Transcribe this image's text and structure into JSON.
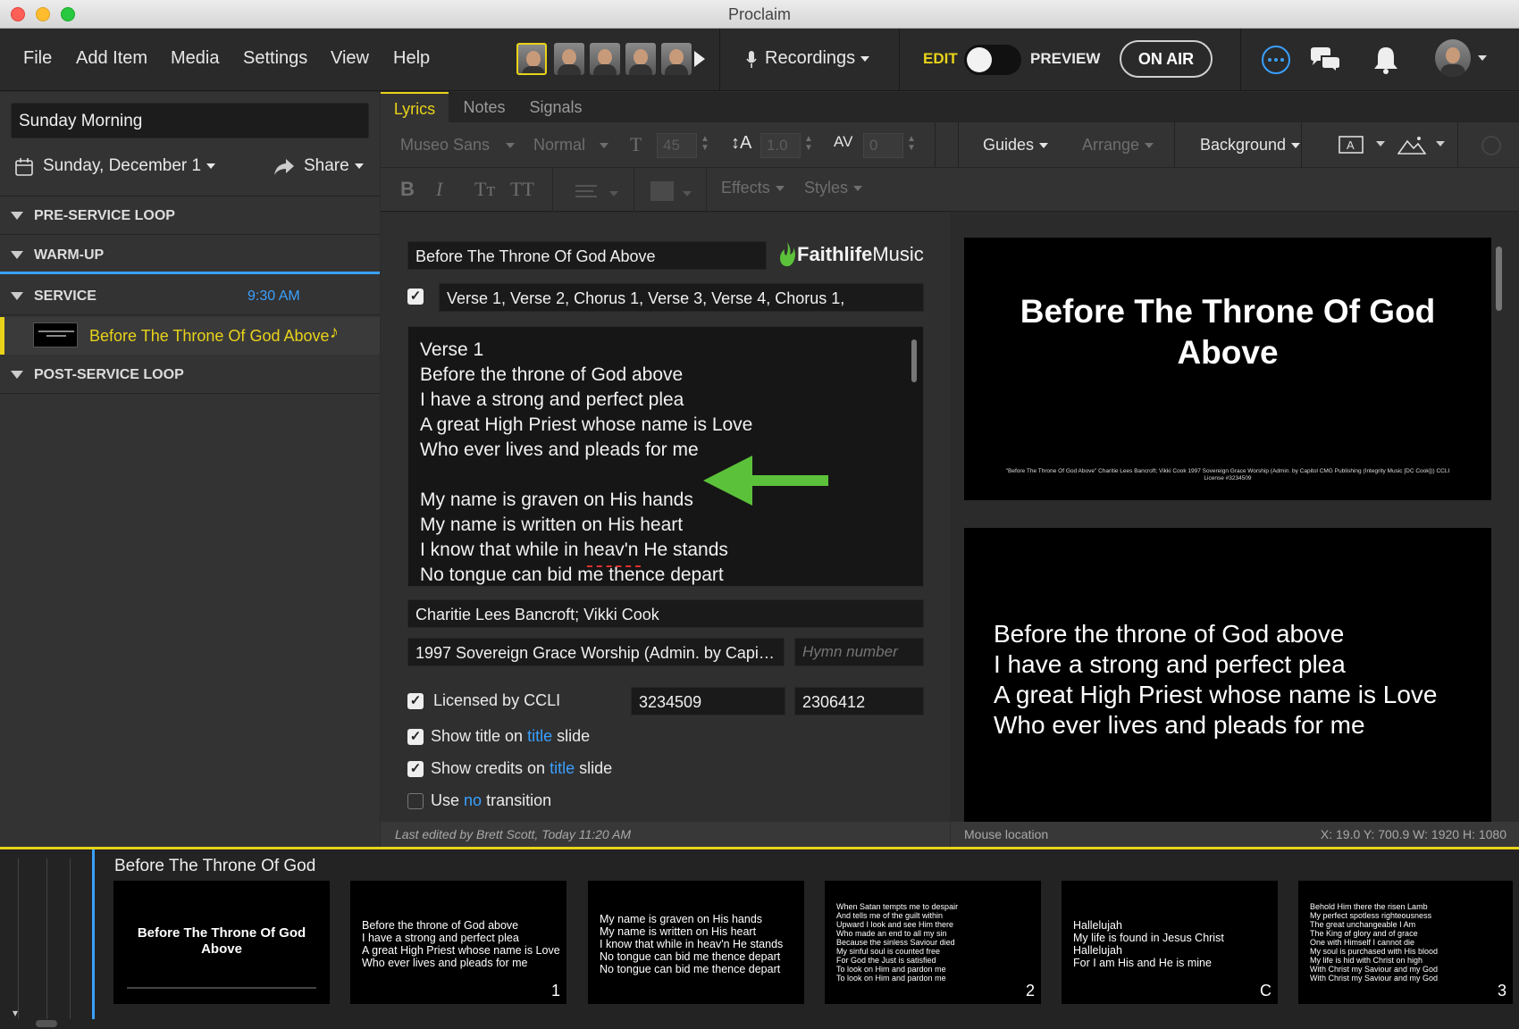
{
  "window": {
    "title": "Proclaim"
  },
  "menu": {
    "file": "File",
    "add_item": "Add Item",
    "media": "Media",
    "settings": "Settings",
    "view": "View",
    "help": "Help",
    "recordings": "Recordings",
    "edit": "EDIT",
    "preview": "PREVIEW",
    "on_air": "ON AIR"
  },
  "colors": {
    "accent_yellow": "#e9d31a",
    "link_blue": "#3aa0ff",
    "arrow_green": "#5cc13a"
  },
  "sidebar": {
    "presentation_name": "Sunday Morning",
    "date": "Sunday, December 1",
    "share": "Share",
    "sections": [
      {
        "label": "PRE-SERVICE LOOP"
      },
      {
        "label": "WARM-UP"
      },
      {
        "label": "SERVICE",
        "time": "9:30 AM"
      },
      {
        "label": "POST-SERVICE LOOP"
      }
    ],
    "service_item": "Before The Throne Of God Above"
  },
  "tabs": [
    "Lyrics",
    "Notes",
    "Signals"
  ],
  "toolbar": {
    "font": "Museo Sans",
    "weight": "Normal",
    "size": "45",
    "line_height": "1.0",
    "spacing": "0",
    "guides": "Guides",
    "arrange": "Arrange",
    "background": "Background",
    "effects": "Effects",
    "styles": "Styles"
  },
  "editor": {
    "title": "Before The Throne Of God Above",
    "brand": {
      "bold": "Faithlife",
      "light": "Music"
    },
    "order": "Verse 1, Verse 2, Chorus 1, Verse 3, Verse 4, Chorus 1,",
    "lyrics": [
      "Verse 1",
      "Before the throne of God above",
      "I have a strong and perfect plea",
      "A great High Priest whose name is Love",
      "Who ever lives and pleads for me",
      "",
      "My name is graven on His hands",
      "My name is written on His heart",
      "I know that while in heav'n He stands",
      "No tongue can bid me thence depart"
    ],
    "authors": "Charitie Lees Bancroft; Vikki Cook",
    "copyright": "1997 Sovereign Grace Worship (Admin. by Capitol CMG Publishing (Integrity Music [DC Cook]))",
    "hymn_placeholder": "Hymn number",
    "licensed": "Licensed by CCLI",
    "ccli_license": "3234509",
    "ccli_song": "2306412",
    "opt_title": {
      "a": "Show title on",
      "link": "title",
      "b": "slide"
    },
    "opt_credits": {
      "a": "Show credits on",
      "link": "title",
      "b": "slide"
    },
    "opt_transition": {
      "a": "Use",
      "link": "no",
      "b": "transition"
    },
    "last_edited": "Last edited by Brett Scott, Today 11:20 AM"
  },
  "preview": {
    "title_slide": {
      "title_line1": "Before The Throne Of God",
      "title_line2": "Above",
      "credit_line1": "\"Before The Throne Of God Above\" Charitie Lees Bancroft; Vikki Cook 1997 Sovereign Grace Worship (Admin. by Capitol CMG Publishing (Integrity Music [DC Cook])) CCLI",
      "credit_line2": "License #3234509"
    },
    "verse_slide": [
      "Before the throne of God above",
      "I have a strong and perfect plea",
      "A great High Priest whose name is Love",
      "Who ever lives and pleads for me"
    ],
    "mouse_location": "Mouse location",
    "coords": "X: 19.0  Y: 700.9   W: 1920  H: 1080"
  },
  "strip": {
    "title": "Before The Throne Of God",
    "slides": [
      {
        "lines": [
          "Before The Throne Of God",
          "Above"
        ],
        "num": ""
      },
      {
        "lines": [
          "Before the throne of God above",
          "I have a strong and perfect plea",
          "A great High Priest whose name is Love",
          "Who ever lives and pleads for me"
        ],
        "num": "1"
      },
      {
        "lines": [
          "My name is graven on His hands",
          "My name is written on His heart",
          "I know that while in heav'n He stands",
          "No tongue can bid me thence depart",
          "No tongue can bid me thence depart"
        ],
        "num": ""
      },
      {
        "lines": [
          "When Satan tempts me to despair",
          "And tells me of the guilt within",
          "Upward I look and see Him there",
          "Who made an end to all my sin",
          "Because the sinless Saviour died",
          "My sinful soul is counted free",
          "For God the Just is satisfied",
          "To look on Him and pardon me",
          "To look on Him and pardon me"
        ],
        "num": "2"
      },
      {
        "lines": [
          "Hallelujah",
          "My life is found in Jesus Christ",
          "Hallelujah",
          "For I am His and He is mine"
        ],
        "num": "C"
      },
      {
        "lines": [
          "Behold Him there the risen Lamb",
          "My perfect spotless righteousness",
          "The great unchangeable I Am",
          "The King of glory and of grace",
          "One with Himself I cannot die",
          "My soul is purchased with His blood",
          "My life is hid with Christ on high",
          "With Christ my Saviour and my God",
          "With Christ my Saviour and my God"
        ],
        "num": "3"
      }
    ]
  }
}
